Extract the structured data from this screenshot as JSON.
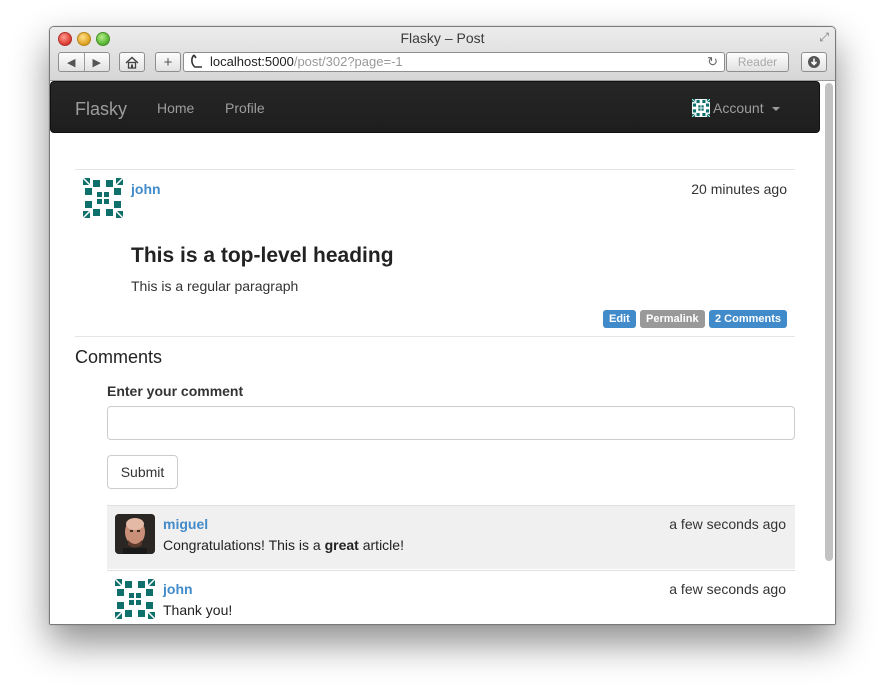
{
  "window": {
    "title": "Flasky – Post"
  },
  "toolbar": {
    "back_icon": "◀",
    "forward_icon": "▶",
    "home_icon": "home-icon",
    "add_label": "+",
    "url_host": "localhost:5000",
    "url_path": "/post/302?page=-1",
    "reader_label": "Reader",
    "reload_icon": "↻"
  },
  "navbar": {
    "brand": "Flasky",
    "links": [
      "Home",
      "Profile"
    ],
    "account_label": "Account"
  },
  "post": {
    "author": "john",
    "timestamp": "20 minutes ago",
    "heading": "This is a top-level heading",
    "body": "This is a regular paragraph",
    "actions": {
      "edit": "Edit",
      "permalink": "Permalink",
      "comments": "2 Comments"
    }
  },
  "comments_section": {
    "title": "Comments",
    "form_label": "Enter your comment",
    "input_value": "",
    "submit_label": "Submit",
    "items": [
      {
        "author": "miguel",
        "timestamp": "a few seconds ago",
        "text_before": "Congratulations! This is a ",
        "text_bold": "great",
        "text_after": " article!",
        "avatar": "photo"
      },
      {
        "author": "john",
        "timestamp": "a few seconds ago",
        "text": "Thank you!",
        "avatar": "identicon"
      }
    ]
  },
  "colors": {
    "link": "#428bca",
    "navbar_bg": "#222222",
    "identicon": "#0f6f6a",
    "label_default": "#999999"
  }
}
